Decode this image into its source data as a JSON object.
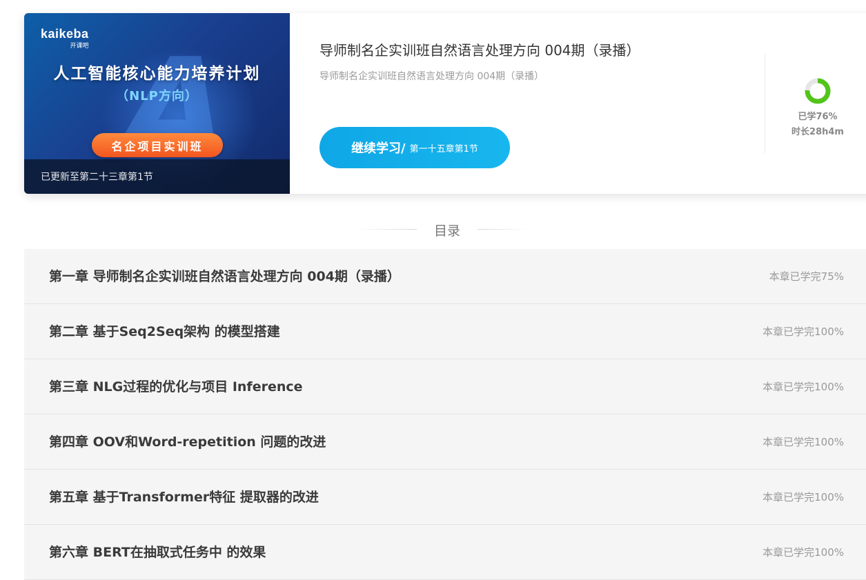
{
  "course": {
    "banner": {
      "logo_text": "kaikeba",
      "logo_subtext": "开课吧",
      "big_letter": "A",
      "title": "人工智能核心能力培养计划",
      "subtitle": "（NLP方向）",
      "pill_label": "名企项目实训班",
      "update_status": "已更新至第二十三章第1节"
    },
    "title": "导师制名企实训班自然语言处理方向 004期（录播）",
    "description": "导师制名企实训班自然语言处理方向 004期（录播）",
    "continue_button": {
      "label": "继续学习/",
      "current_section": "第一十五章第1节"
    },
    "progress": {
      "percent": 76,
      "label": "已学76%",
      "duration": "时长28h4m",
      "color": "#52c41a"
    }
  },
  "catalog": {
    "title": "目录",
    "chapters": [
      {
        "title": "第一章 导师制名企实训班自然语言处理方向 004期（录播）",
        "progress": "本章已学完75%"
      },
      {
        "title": "第二章 基于Seq2Seq架构 的模型搭建",
        "progress": "本章已学完100%"
      },
      {
        "title": "第三章 NLG过程的优化与项目 Inference",
        "progress": "本章已学完100%"
      },
      {
        "title": "第四章 OOV和Word-repetition 问题的改进",
        "progress": "本章已学完100%"
      },
      {
        "title": "第五章 基于Transformer特征 提取器的改进",
        "progress": "本章已学完100%"
      },
      {
        "title": "第六章 BERT在抽取式任务中 的效果",
        "progress": "本章已学完100%"
      }
    ]
  }
}
